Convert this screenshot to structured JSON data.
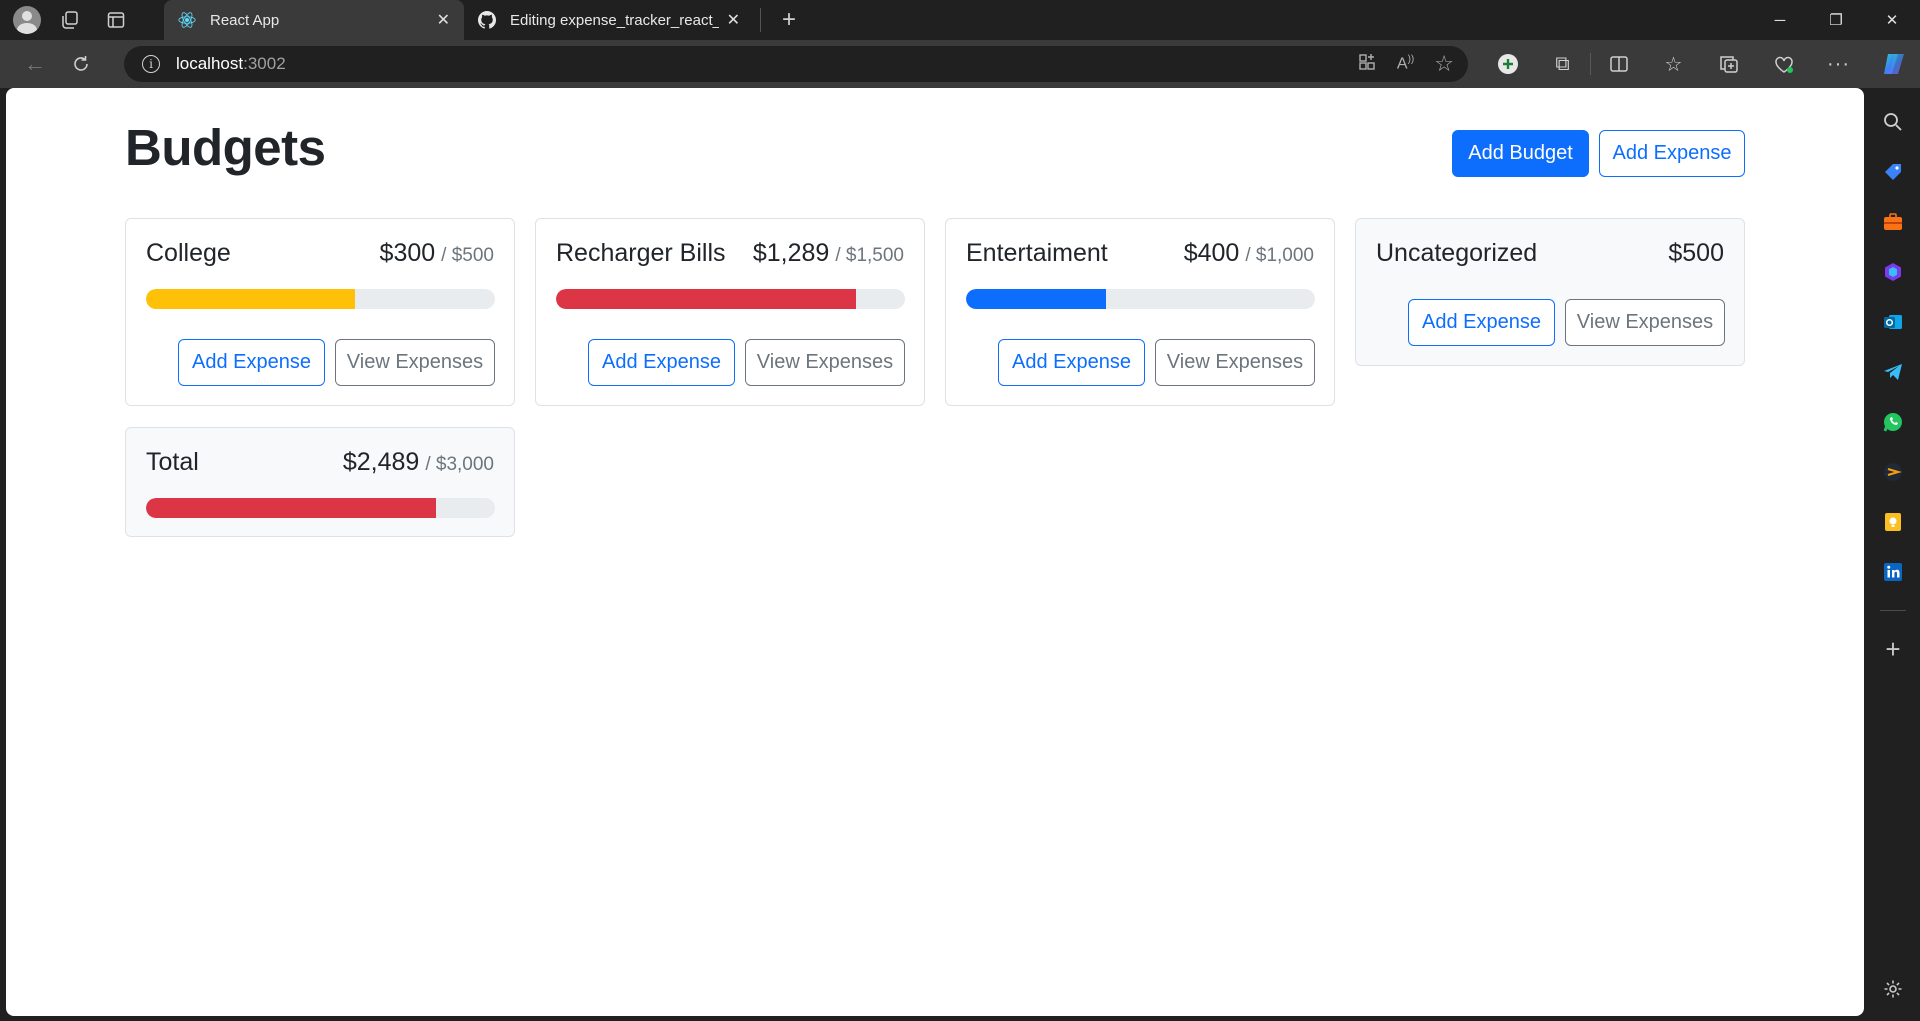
{
  "browser": {
    "tabs": [
      {
        "title": "React App",
        "active": true
      },
      {
        "title": "Editing expense_tracker_react_ap",
        "active": false
      }
    ],
    "url_host": "localhost",
    "url_port": ":3002"
  },
  "page": {
    "title": "Budgets",
    "add_budget_label": "Add Budget",
    "add_expense_label": "Add Expense"
  },
  "budgets": [
    {
      "name": "College",
      "amount": "$300",
      "max": "/ $500",
      "progress": 0.6,
      "color": "#ffc107",
      "add_label": "Add Expense",
      "view_label": "View Expenses"
    },
    {
      "name": "Recharger Bills",
      "amount": "$1,289",
      "max": "/ $1,500",
      "progress": 0.859,
      "color": "#dc3545",
      "add_label": "Add Expense",
      "view_label": "View Expenses"
    },
    {
      "name": "Entertaiment",
      "amount": "$400",
      "max": "/ $1,000",
      "progress": 0.4,
      "color": "#0d6efd",
      "add_label": "Add Expense",
      "view_label": "View Expenses"
    }
  ],
  "uncategorized": {
    "name": "Uncategorized",
    "amount": "$500",
    "add_label": "Add Expense",
    "view_label": "View Expenses"
  },
  "total": {
    "name": "Total",
    "amount": "$2,489",
    "max": "/ $3,000",
    "progress": 0.83,
    "color": "#dc3545"
  },
  "colors": {
    "primary": "#0d6efd",
    "warning": "#ffc107",
    "danger": "#dc3545",
    "secondary": "#6c757d"
  }
}
